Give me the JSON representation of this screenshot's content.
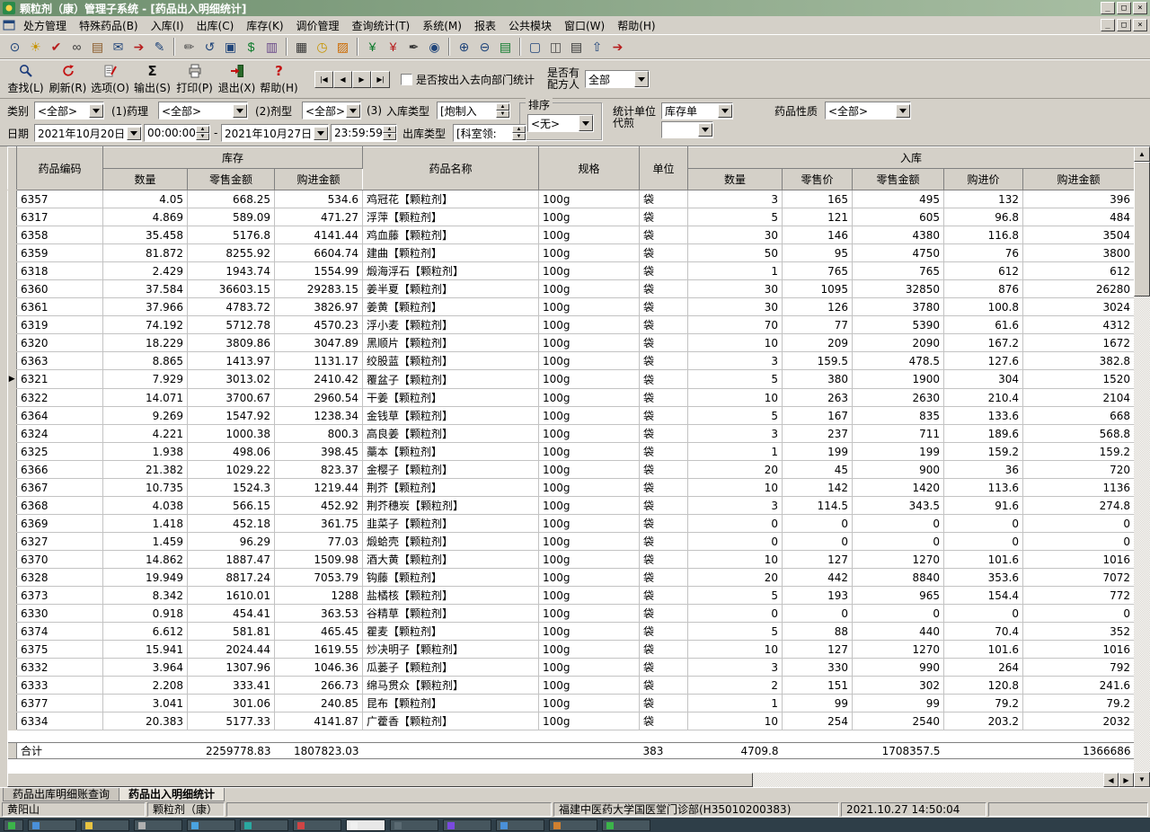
{
  "window": {
    "title": "颗粒剂（康）管理子系统 - [药品出入明细统计]"
  },
  "window_controls": {
    "minimize": "_",
    "restore": "□",
    "close": "×"
  },
  "menu": {
    "items": [
      "处方管理",
      "特殊药品(B)",
      "入库(I)",
      "出库(C)",
      "库存(K)",
      "调价管理",
      "查询统计(T)",
      "系统(M)",
      "报表",
      "公共模块",
      "窗口(W)",
      "帮助(H)"
    ]
  },
  "toolbar": {
    "icons": [
      {
        "name": "preview-doc-icon",
        "glyph": "⊙",
        "color": "#20457a"
      },
      {
        "name": "lamp-icon",
        "glyph": "☀",
        "color": "#c79400"
      },
      {
        "name": "audit-check-icon",
        "glyph": "✔",
        "color": "#b71c1c"
      },
      {
        "name": "binoculars-icon",
        "glyph": "∞",
        "color": "#3a3a3a"
      },
      {
        "name": "archive-books-icon",
        "glyph": "▤",
        "color": "#8a5a28"
      },
      {
        "name": "inbound-mail-icon",
        "glyph": "✉",
        "color": "#20457a"
      },
      {
        "name": "outbound-doc-icon",
        "glyph": "➔",
        "color": "#b71c1c"
      },
      {
        "name": "edit-doc-icon",
        "glyph": "✎",
        "color": "#20457a"
      },
      {
        "sep": true
      },
      {
        "name": "note-icon",
        "glyph": "✏",
        "color": "#4a4a4a"
      },
      {
        "name": "return-goods-icon",
        "glyph": "↺",
        "color": "#20457a"
      },
      {
        "name": "computer-icon",
        "glyph": "▣",
        "color": "#20457a"
      },
      {
        "name": "settlement-money-icon",
        "glyph": "$",
        "color": "#0a7a2a"
      },
      {
        "name": "ledger-icon",
        "glyph": "▥",
        "color": "#6a4a8a"
      },
      {
        "sep": true
      },
      {
        "name": "table-grid-icon",
        "glyph": "▦",
        "color": "#333333"
      },
      {
        "name": "alarm-clock-icon",
        "glyph": "◷",
        "color": "#c79400"
      },
      {
        "name": "picture-icon",
        "glyph": "▨",
        "color": "#cc6a00"
      },
      {
        "sep": true
      },
      {
        "name": "cash-in-icon",
        "glyph": "¥",
        "color": "#0a7a2a"
      },
      {
        "name": "cash-out-icon",
        "glyph": "¥",
        "color": "#b71c1c"
      },
      {
        "name": "invoice-pen-icon",
        "glyph": "✒",
        "color": "#333333"
      },
      {
        "name": "globe-icon",
        "glyph": "◉",
        "color": "#20457a"
      },
      {
        "sep": true
      },
      {
        "name": "zoom-in-icon",
        "glyph": "⊕",
        "color": "#20457a"
      },
      {
        "name": "zoom-out-icon",
        "glyph": "⊖",
        "color": "#20457a"
      },
      {
        "name": "books-icon",
        "glyph": "▤",
        "color": "#0a7a2a"
      },
      {
        "sep": true
      },
      {
        "name": "window-icon",
        "glyph": "▢",
        "color": "#20457a"
      },
      {
        "name": "pages-icon",
        "glyph": "◫",
        "color": "#4a4a4a"
      },
      {
        "name": "print-small-icon",
        "glyph": "▤",
        "color": "#333333"
      },
      {
        "name": "export-page-icon",
        "glyph": "⇧",
        "color": "#20457a"
      },
      {
        "name": "exit-door-icon",
        "glyph": "➔",
        "color": "#b71c1c"
      }
    ]
  },
  "actions": {
    "buttons": [
      {
        "label": "查找(L)"
      },
      {
        "label": "刷新(R)"
      },
      {
        "label": "选项(O)"
      },
      {
        "label": "输出(S)"
      },
      {
        "label": "打印(P)"
      },
      {
        "label": "退出(X)"
      },
      {
        "label": "帮助(H)"
      }
    ],
    "nav": [
      "|◀",
      "◀",
      "▶",
      "▶|"
    ],
    "dept_stat_label": "是否按出入去向部门统计",
    "formula_label_1": "是否有",
    "formula_label_2": "配方人",
    "formula_value": "全部"
  },
  "filters": {
    "category_label": "类别",
    "category_value": "<全部>",
    "pharm_label": "(1)药理",
    "pharm_value": "<全部>",
    "form_label": "(2)剂型",
    "form_value": "<全部>",
    "seq3_label": "(3)",
    "in_type_label": "入库类型",
    "in_type_value": "[炮制入",
    "sort_label": "排序",
    "sort_value": "<无>",
    "stat_unit_label_1": "统计单位",
    "stat_unit_label_2": "代煎",
    "stat_unit_value_1": "库存单",
    "stat_unit_value_2": "",
    "property_label": "药品性质",
    "property_value": "<全部>",
    "date_label": "日期",
    "date_from": "2021年10月20日",
    "time_from": "00:00:00",
    "range_sep": "-",
    "date_to": "2021年10月27日",
    "time_to": "23:59:59",
    "out_type_label": "出库类型",
    "out_type_value": "[科室领:"
  },
  "table": {
    "header": {
      "code": "药品编码",
      "stock": "库存",
      "name": "药品名称",
      "spec": "规格",
      "unit": "单位",
      "inbound": "入库"
    },
    "sub": [
      "数量",
      "零售金额",
      "购进金额",
      "数量",
      "零售价",
      "零售金额",
      "购进价",
      "购进金额"
    ],
    "current_row": 10,
    "rows": [
      [
        "6357",
        "4.05",
        "668.25",
        "534.6",
        "鸡冠花【颗粒剂】",
        "100g",
        "袋",
        "3",
        "165",
        "495",
        "132",
        "396"
      ],
      [
        "6317",
        "4.869",
        "589.09",
        "471.27",
        "浮萍【颗粒剂】",
        "100g",
        "袋",
        "5",
        "121",
        "605",
        "96.8",
        "484"
      ],
      [
        "6358",
        "35.458",
        "5176.8",
        "4141.44",
        "鸡血藤【颗粒剂】",
        "100g",
        "袋",
        "30",
        "146",
        "4380",
        "116.8",
        "3504"
      ],
      [
        "6359",
        "81.872",
        "8255.92",
        "6604.74",
        "建曲【颗粒剂】",
        "100g",
        "袋",
        "50",
        "95",
        "4750",
        "76",
        "3800"
      ],
      [
        "6318",
        "2.429",
        "1943.74",
        "1554.99",
        "煅海浮石【颗粒剂】",
        "100g",
        "袋",
        "1",
        "765",
        "765",
        "612",
        "612"
      ],
      [
        "6360",
        "37.584",
        "36603.15",
        "29283.15",
        "姜半夏【颗粒剂】",
        "100g",
        "袋",
        "30",
        "1095",
        "32850",
        "876",
        "26280"
      ],
      [
        "6361",
        "37.966",
        "4783.72",
        "3826.97",
        "姜黄【颗粒剂】",
        "100g",
        "袋",
        "30",
        "126",
        "3780",
        "100.8",
        "3024"
      ],
      [
        "6319",
        "74.192",
        "5712.78",
        "4570.23",
        "浮小麦【颗粒剂】",
        "100g",
        "袋",
        "70",
        "77",
        "5390",
        "61.6",
        "4312"
      ],
      [
        "6320",
        "18.229",
        "3809.86",
        "3047.89",
        "黑顺片【颗粒剂】",
        "100g",
        "袋",
        "10",
        "209",
        "2090",
        "167.2",
        "1672"
      ],
      [
        "6363",
        "8.865",
        "1413.97",
        "1131.17",
        "绞股蓝【颗粒剂】",
        "100g",
        "袋",
        "3",
        "159.5",
        "478.5",
        "127.6",
        "382.8"
      ],
      [
        "6321",
        "7.929",
        "3013.02",
        "2410.42",
        "覆盆子【颗粒剂】",
        "100g",
        "袋",
        "5",
        "380",
        "1900",
        "304",
        "1520"
      ],
      [
        "6322",
        "14.071",
        "3700.67",
        "2960.54",
        "干姜【颗粒剂】",
        "100g",
        "袋",
        "10",
        "263",
        "2630",
        "210.4",
        "2104"
      ],
      [
        "6364",
        "9.269",
        "1547.92",
        "1238.34",
        "金钱草【颗粒剂】",
        "100g",
        "袋",
        "5",
        "167",
        "835",
        "133.6",
        "668"
      ],
      [
        "6324",
        "4.221",
        "1000.38",
        "800.3",
        "高良姜【颗粒剂】",
        "100g",
        "袋",
        "3",
        "237",
        "711",
        "189.6",
        "568.8"
      ],
      [
        "6325",
        "1.938",
        "498.06",
        "398.45",
        "藁本【颗粒剂】",
        "100g",
        "袋",
        "1",
        "199",
        "199",
        "159.2",
        "159.2"
      ],
      [
        "6366",
        "21.382",
        "1029.22",
        "823.37",
        "金樱子【颗粒剂】",
        "100g",
        "袋",
        "20",
        "45",
        "900",
        "36",
        "720"
      ],
      [
        "6367",
        "10.735",
        "1524.3",
        "1219.44",
        "荆芥【颗粒剂】",
        "100g",
        "袋",
        "10",
        "142",
        "1420",
        "113.6",
        "1136"
      ],
      [
        "6368",
        "4.038",
        "566.15",
        "452.92",
        "荆芥穗炭【颗粒剂】",
        "100g",
        "袋",
        "3",
        "114.5",
        "343.5",
        "91.6",
        "274.8"
      ],
      [
        "6369",
        "1.418",
        "452.18",
        "361.75",
        "韭菜子【颗粒剂】",
        "100g",
        "袋",
        "0",
        "0",
        "0",
        "0",
        "0"
      ],
      [
        "6327",
        "1.459",
        "96.29",
        "77.03",
        "煅蛤壳【颗粒剂】",
        "100g",
        "袋",
        "0",
        "0",
        "0",
        "0",
        "0"
      ],
      [
        "6370",
        "14.862",
        "1887.47",
        "1509.98",
        "酒大黄【颗粒剂】",
        "100g",
        "袋",
        "10",
        "127",
        "1270",
        "101.6",
        "1016"
      ],
      [
        "6328",
        "19.949",
        "8817.24",
        "7053.79",
        "钩藤【颗粒剂】",
        "100g",
        "袋",
        "20",
        "442",
        "8840",
        "353.6",
        "7072"
      ],
      [
        "6373",
        "8.342",
        "1610.01",
        "1288",
        "盐橘核【颗粒剂】",
        "100g",
        "袋",
        "5",
        "193",
        "965",
        "154.4",
        "772"
      ],
      [
        "6330",
        "0.918",
        "454.41",
        "363.53",
        "谷精草【颗粒剂】",
        "100g",
        "袋",
        "0",
        "0",
        "0",
        "0",
        "0"
      ],
      [
        "6374",
        "6.612",
        "581.81",
        "465.45",
        "瞿麦【颗粒剂】",
        "100g",
        "袋",
        "5",
        "88",
        "440",
        "70.4",
        "352"
      ],
      [
        "6375",
        "15.941",
        "2024.44",
        "1619.55",
        "炒决明子【颗粒剂】",
        "100g",
        "袋",
        "10",
        "127",
        "1270",
        "101.6",
        "1016"
      ],
      [
        "6332",
        "3.964",
        "1307.96",
        "1046.36",
        "瓜蒌子【颗粒剂】",
        "100g",
        "袋",
        "3",
        "330",
        "990",
        "264",
        "792"
      ],
      [
        "6333",
        "2.208",
        "333.41",
        "266.73",
        "绵马贯众【颗粒剂】",
        "100g",
        "袋",
        "2",
        "151",
        "302",
        "120.8",
        "241.6"
      ],
      [
        "6377",
        "3.041",
        "301.06",
        "240.85",
        "昆布【颗粒剂】",
        "100g",
        "袋",
        "1",
        "99",
        "99",
        "79.2",
        "79.2"
      ],
      [
        "6334",
        "20.383",
        "5177.33",
        "4141.87",
        "广藿香【颗粒剂】",
        "100g",
        "袋",
        "10",
        "254",
        "2540",
        "203.2",
        "2032"
      ]
    ],
    "total": [
      "合计",
      "",
      "2259778.83",
      "1807823.03",
      "",
      "",
      "383",
      "4709.8",
      "",
      "1708357.5",
      "",
      "1366686"
    ]
  },
  "tabs": {
    "items": [
      {
        "name": "tab-drug-out-ledger-query",
        "label": "药品出库明细账查询",
        "active": false
      },
      {
        "name": "tab-drug-inout-detail-stats",
        "label": "药品出入明细统计",
        "active": true
      }
    ]
  },
  "statusbar": {
    "user": "黄阳山",
    "module": "颗粒剂（康）",
    "org": "福建中医药大学国医堂门诊部(H35010200383)",
    "datetime": "2021.10.27 14:50:04"
  },
  "taskbar": {
    "items": [
      {
        "name": "taskbar-start-button",
        "color": "#3cb44a",
        "wide": false
      },
      {
        "name": "taskbar-app-1",
        "color": "#4a90d9",
        "wide": false
      },
      {
        "name": "taskbar-app-2",
        "color": "#e8c341",
        "wide": false
      },
      {
        "name": "taskbar-app-3",
        "color": "#b0b0b0",
        "wide": false
      },
      {
        "name": "taskbar-app-4",
        "color": "#4aa3e0",
        "wide": false
      },
      {
        "name": "taskbar-app-5",
        "color": "#2aa8a0",
        "wide": false
      },
      {
        "name": "taskbar-app-6",
        "color": "#d04545",
        "wide": false
      },
      {
        "name": "taskbar-app-7",
        "color": "#f0f0f0",
        "wide": true
      },
      {
        "name": "taskbar-app-8",
        "color": "#5a6a72",
        "wide": false
      },
      {
        "name": "taskbar-app-9",
        "color": "#7a4ae0",
        "wide": false
      },
      {
        "name": "taskbar-app-10",
        "color": "#4a90d9",
        "wide": false
      },
      {
        "name": "taskbar-app-11",
        "color": "#d08030",
        "wide": false
      },
      {
        "name": "taskbar-app-12",
        "color": "#3cb44a",
        "wide": false
      }
    ]
  }
}
